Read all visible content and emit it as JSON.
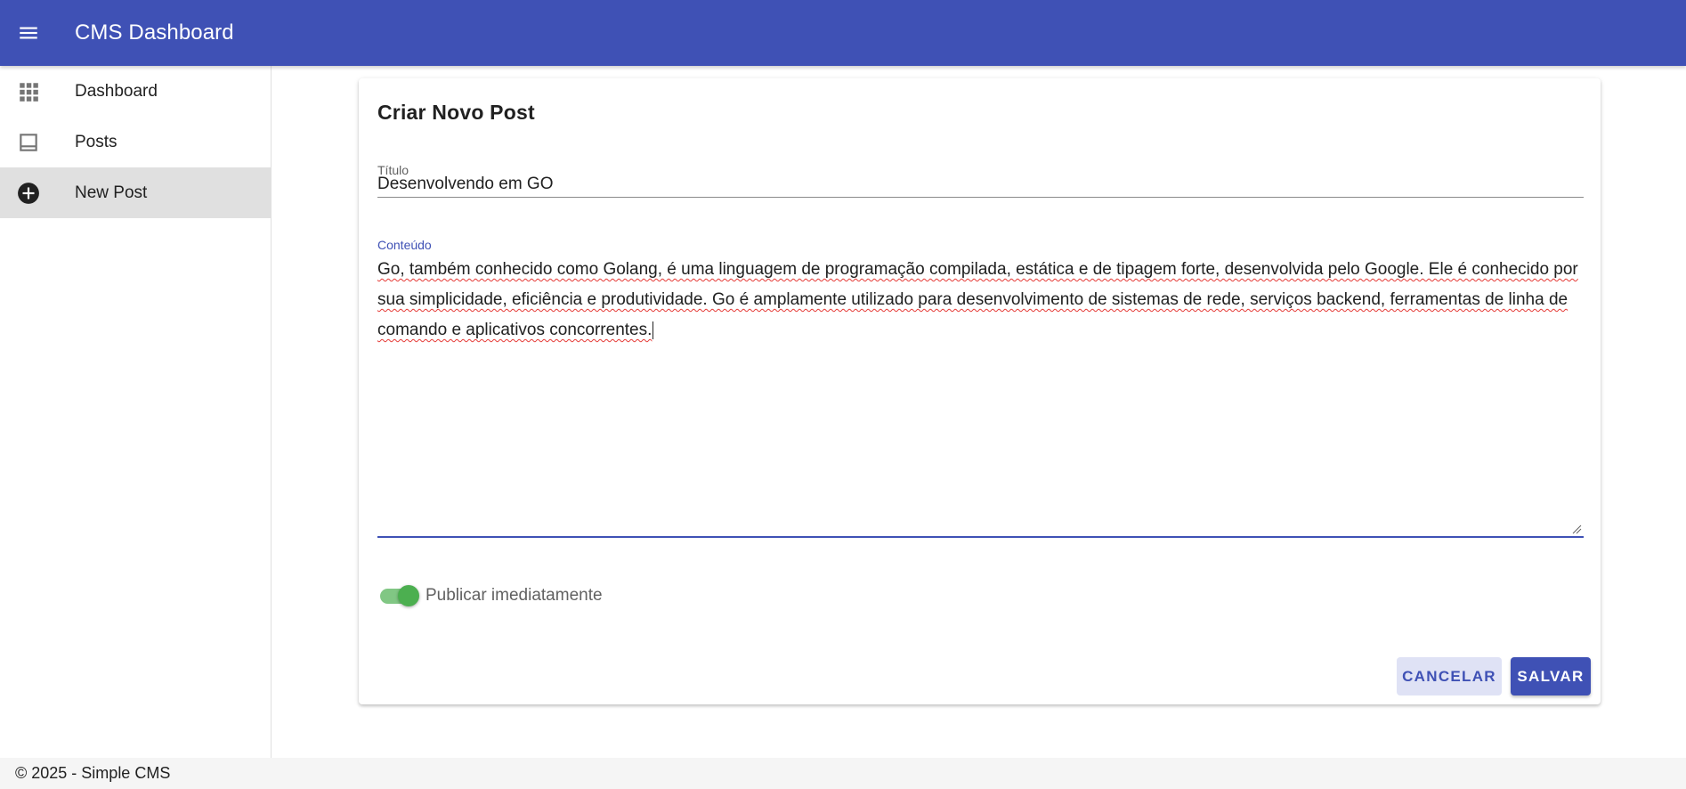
{
  "app": {
    "title": "CMS Dashboard"
  },
  "sidebar": {
    "items": [
      {
        "label": "Dashboard",
        "icon": "apps-grid-icon",
        "active": false
      },
      {
        "label": "Posts",
        "icon": "article-icon",
        "active": false
      },
      {
        "label": "New Post",
        "icon": "add-circle-icon",
        "active": true
      }
    ]
  },
  "form": {
    "heading": "Criar Novo Post",
    "title_label": "Título",
    "title_value": "Desenvolvendo em GO",
    "content_label": "Conteúdo",
    "content_value": "Go, também conhecido como Golang, é uma linguagem de programação compilada, estática e de tipagem forte, desenvolvida pelo Google. Ele é conhecido por sua simplicidade, eficiência e produtividade. Go é amplamente utilizado para desenvolvimento de sistemas de rede, serviços backend, ferramentas de linha de comando e aplicativos concorrentes.",
    "publish_label": "Publicar imediatamente",
    "publish_checked": true,
    "cancel_label": "CANCELAR",
    "save_label": "SALVAR"
  },
  "footer": {
    "text": "© 2025 - Simple CMS"
  },
  "colors": {
    "primary": "#3f51b5",
    "switch_on": "#4caf50",
    "spellcheck": "#e53935"
  }
}
